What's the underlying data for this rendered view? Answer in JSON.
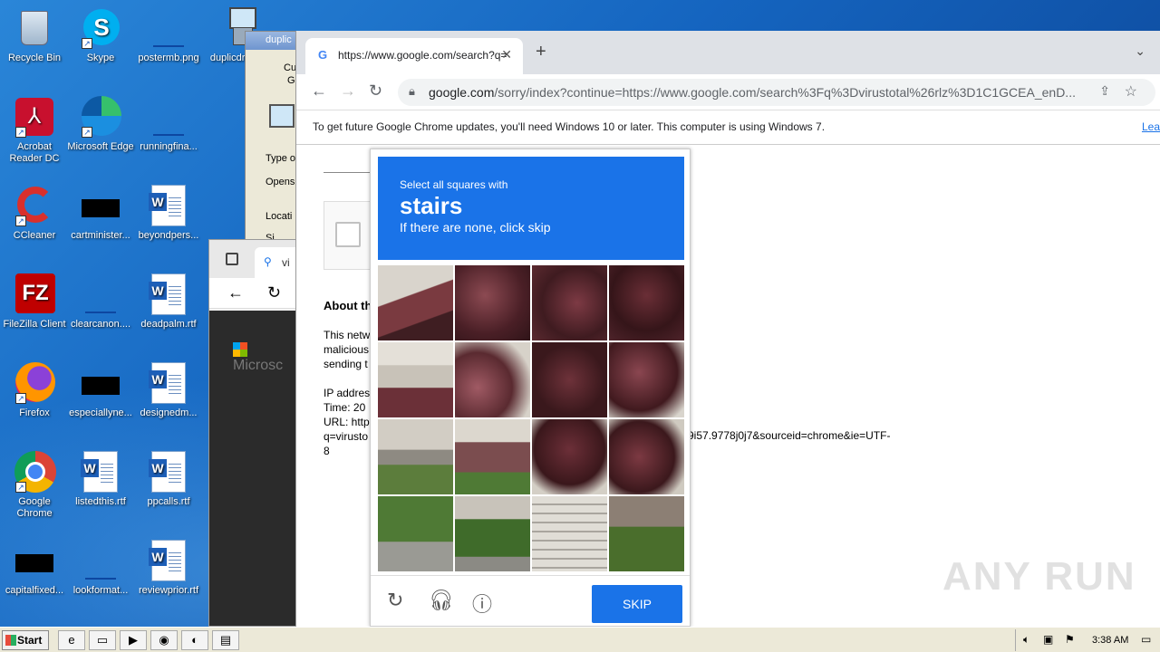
{
  "desktop": {
    "icons": [
      {
        "label": "Recycle Bin"
      },
      {
        "label": "Skype"
      },
      {
        "label": "postermb.png"
      },
      {
        "label": "duplicdri5..."
      },
      {
        "label": "Acrobat Reader DC"
      },
      {
        "label": "Microsoft Edge"
      },
      {
        "label": "runningfina..."
      },
      {
        "label": "CCleaner"
      },
      {
        "label": "cartminister..."
      },
      {
        "label": "beyondpers..."
      },
      {
        "label": "FileZilla Client"
      },
      {
        "label": "clearcanon...."
      },
      {
        "label": "deadpalm.rtf"
      },
      {
        "label": "Firefox"
      },
      {
        "label": "especiallyne..."
      },
      {
        "label": "designedm..."
      },
      {
        "label": "Google Chrome"
      },
      {
        "label": "listedthis.rtf"
      },
      {
        "label": "ppcalls.rtf"
      },
      {
        "label": "capitalfixed..."
      },
      {
        "label": "lookformat..."
      },
      {
        "label": "reviewprior.rtf"
      }
    ]
  },
  "background_window": {
    "title": "duplic",
    "labels": [
      "Cu",
      "G",
      "Type o",
      "Opens",
      "Locati",
      "Si"
    ]
  },
  "edge_window": {
    "tab_text": "vi",
    "logo_text": "Microsc"
  },
  "chrome": {
    "tab_title": "https://www.google.com/search?q=",
    "tab_favicon": "G",
    "address_host": "google.com",
    "address_path": "/sorry/index?continue=https://www.google.com/search%3Fq%3Dvirustotal%26rlz%3D1C1GCEA_enD...",
    "infobar_text": "To get future Google Chrome updates, you'll need Windows 10 or later. This computer is using Windows 7.",
    "infobar_link": "Lea",
    "page": {
      "about_heading": "About th",
      "p1_line1": "This netw",
      "p1_line2": "malicious",
      "p1_line3": "sending t",
      "ip_label": "IP addres",
      "time_label": "Time: 20",
      "url_label": "URL: http",
      "q_label": "q=virusto",
      "eight": "8",
      "url_rest": "9i57.9778j0j7&sourceid=chrome&ie=UTF-"
    }
  },
  "captcha": {
    "instruction": "Select all squares with",
    "target": "stairs",
    "hint": "If there are none, click skip",
    "skip_label": "SKIP"
  },
  "watermark": "ANY RUN",
  "taskbar": {
    "start_label": "Start",
    "clock": "3:38 AM"
  }
}
